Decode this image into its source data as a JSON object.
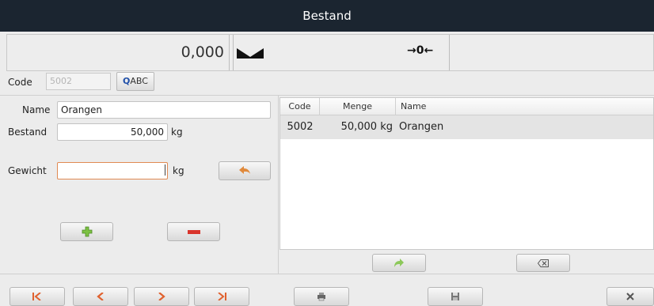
{
  "window": {
    "title": "Bestand"
  },
  "scale": {
    "weight": "0,000",
    "zero_indicator": "→0←",
    "colors": {
      "titlebar_bg": "#1b2530"
    }
  },
  "code": {
    "label": "Code",
    "value": "5002",
    "search_button_label": "ABC"
  },
  "form": {
    "name_label": "Name",
    "name_value": "Orangen",
    "stock_label": "Bestand",
    "stock_value": "50,000",
    "stock_unit": "kg",
    "weight_label": "Gewicht",
    "weight_value": "",
    "weight_unit": "kg"
  },
  "table": {
    "headers": {
      "code": "Code",
      "menge": "Menge",
      "name": "Name"
    },
    "rows": [
      {
        "code": "5002",
        "menge": "50,000 kg",
        "name": "Orangen"
      }
    ]
  },
  "icons": {
    "back": "undo-arrow-icon",
    "add": "plus-icon",
    "remove": "minus-icon",
    "forward": "forward-arrow-icon",
    "backspace": "backspace-icon",
    "first": "first-page-icon",
    "prev": "previous-icon",
    "next": "next-icon",
    "last": "last-page-icon",
    "print": "printer-icon",
    "save": "save-icon",
    "close": "close-icon"
  }
}
